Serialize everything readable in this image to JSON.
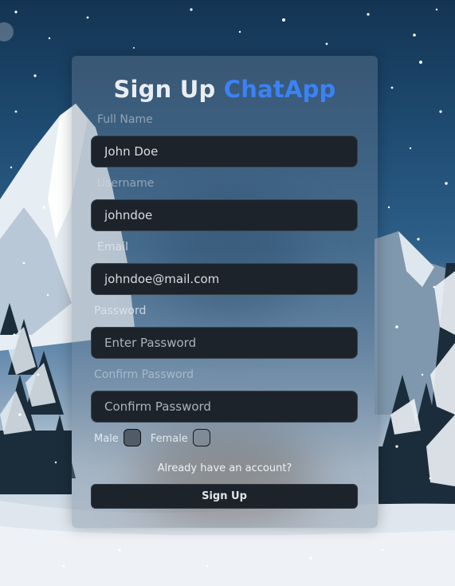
{
  "form": {
    "title": "Sign Up",
    "brand": "ChatApp",
    "fields": {
      "full_name": {
        "label": "Full Name",
        "value": "John Doe"
      },
      "username": {
        "label": "Username",
        "value": "johndoe"
      },
      "email": {
        "label": "Email",
        "value": "johndoe@mail.com"
      },
      "password": {
        "label": "Password",
        "placeholder": "Enter Password"
      },
      "confirm_password": {
        "label": "Confirm Password",
        "placeholder": "Confirm Password"
      }
    },
    "gender": {
      "male_label": "Male",
      "female_label": "Female"
    },
    "login_link": "Already have an account?",
    "submit_label": "Sign Up"
  },
  "colors": {
    "accent": "#3b82f6",
    "input_bg": "#1d232a",
    "card_tint": "rgba(110,130,150,0.38)"
  }
}
